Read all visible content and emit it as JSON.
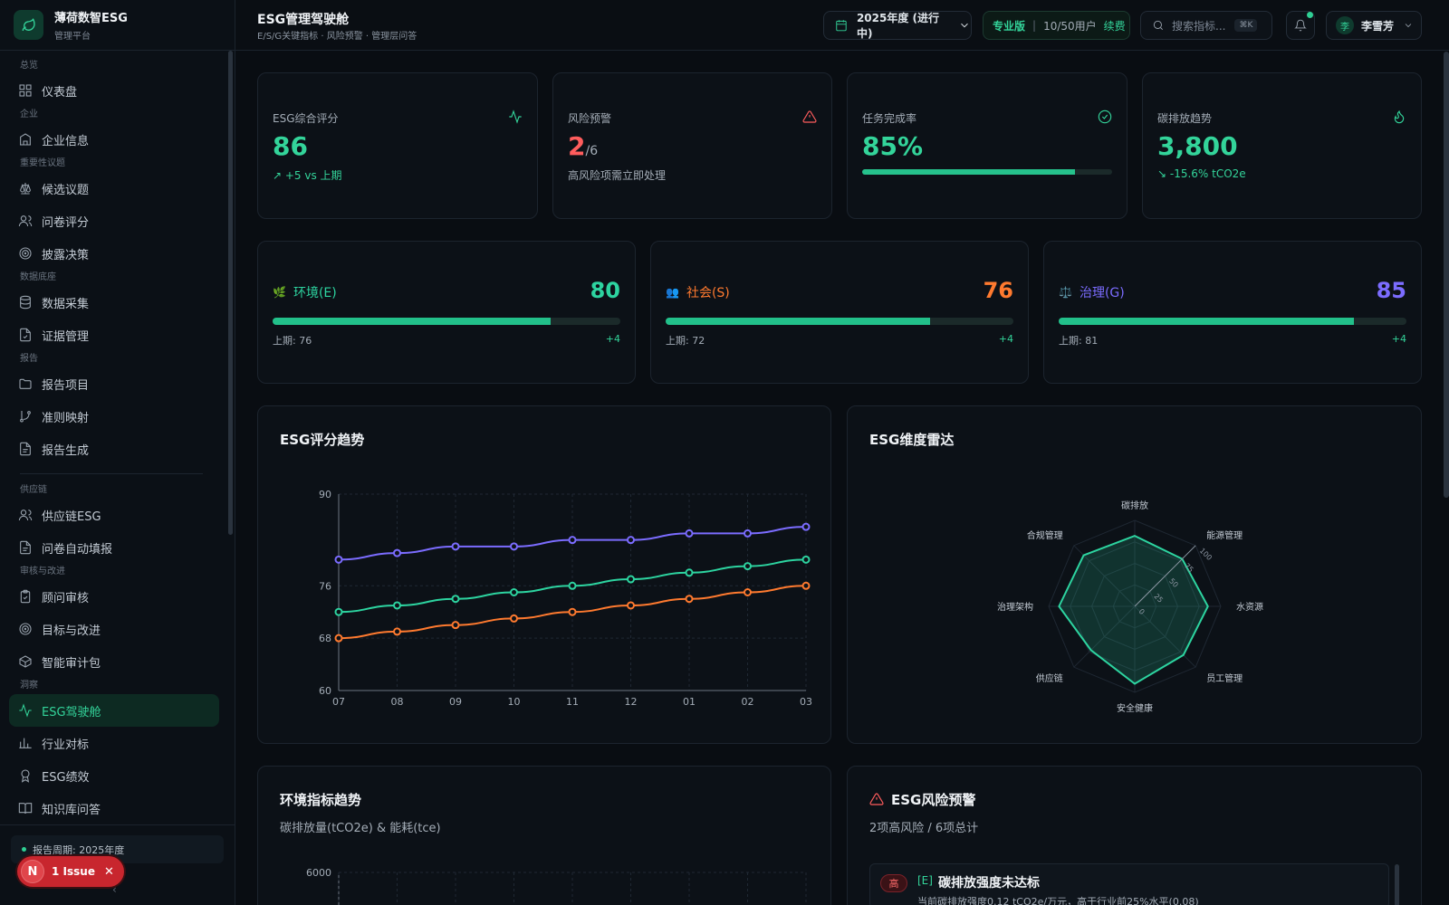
{
  "brand": {
    "name": "薄荷数智ESG",
    "sub": "管理平台"
  },
  "sidebar": {
    "groups": {
      "overview": "总览",
      "company": "企业",
      "materiality": "重要性议题",
      "data": "数据底座",
      "report": "报告",
      "supply": "供应链",
      "audit": "审核与改进",
      "insight": "洞察"
    },
    "items": [
      {
        "label": "仪表盘",
        "icon": "grid-icon"
      },
      {
        "label": "企业信息",
        "icon": "building-icon"
      },
      {
        "label": "候选议题",
        "icon": "scale-icon"
      },
      {
        "label": "问卷评分",
        "icon": "users-icon"
      },
      {
        "label": "披露决策",
        "icon": "target-icon"
      },
      {
        "label": "数据采集",
        "icon": "database-icon"
      },
      {
        "label": "证据管理",
        "icon": "file-check-icon"
      },
      {
        "label": "报告项目",
        "icon": "folder-icon"
      },
      {
        "label": "准则映射",
        "icon": "git-branch-icon"
      },
      {
        "label": "报告生成",
        "icon": "file-text-icon"
      },
      {
        "label": "供应链ESG",
        "icon": "users-icon"
      },
      {
        "label": "问卷自动填报",
        "icon": "file-text-icon"
      },
      {
        "label": "顾问审核",
        "icon": "clipboard-icon"
      },
      {
        "label": "目标与改进",
        "icon": "target-icon"
      },
      {
        "label": "智能审计包",
        "icon": "package-icon"
      },
      {
        "label": "ESG驾驶舱",
        "icon": "activity-icon"
      },
      {
        "label": "行业对标",
        "icon": "bar-chart-icon"
      },
      {
        "label": "ESG绩效",
        "icon": "award-icon"
      },
      {
        "label": "知识库问答",
        "icon": "book-icon"
      }
    ],
    "period": "报告周期: 2025年度",
    "collapse": "‹"
  },
  "issue": {
    "avatar": "N",
    "label": "1 Issue",
    "close": "✕"
  },
  "header": {
    "title": "ESG管理驾驶舱",
    "subtitle": "E/S/G关键指标 · 风险预警 · 管理层问答",
    "year": "2025年度 (进行中)",
    "plan": "专业版",
    "users": "10/50用户",
    "renew": "续费",
    "search_placeholder": "搜索指标...",
    "shortcut": "⌘K",
    "user_avatar": "李",
    "user_name": "李雪芳"
  },
  "kpis": {
    "score": {
      "label": "ESG综合评分",
      "value": "86",
      "note": "↗ +5 vs 上期"
    },
    "risk": {
      "label": "风险预警",
      "value": "2",
      "total": "/6",
      "note": "高风险项需立即处理"
    },
    "task": {
      "label": "任务完成率",
      "value": "85%",
      "progress": 0.85
    },
    "carbon": {
      "label": "碳排放趋势",
      "value": "3,800",
      "note": "↘ -15.6% tCO2e"
    }
  },
  "dimensions": {
    "e": {
      "icon": "🌿",
      "label": "环境(E)",
      "score": "80",
      "progress": 0.8,
      "prev": "上期: 76",
      "delta": "+4",
      "color": "#2dd4a0"
    },
    "s": {
      "icon": "👥",
      "label": "社会(S)",
      "score": "76",
      "progress": 0.76,
      "prev": "上期: 72",
      "delta": "+4",
      "color": "#ff7a2f"
    },
    "g": {
      "icon": "⚖️",
      "label": "治理(G)",
      "score": "85",
      "progress": 0.85,
      "prev": "上期: 81",
      "delta": "+4",
      "color": "#7b6cff"
    }
  },
  "trend": {
    "title": "ESG评分趋势"
  },
  "radar": {
    "title": "ESG维度雷达"
  },
  "env": {
    "title": "环境指标趋势",
    "subtitle": "碳排放量(tCO2e) & 能耗(tce)"
  },
  "risks": {
    "title": "ESG风险预警",
    "subtitle": "2项高风险 / 6项总计",
    "items": [
      {
        "level": "高",
        "tag": "[E]",
        "title": "碳排放强度未达标",
        "desc": "当前碳排放强度0.12 tCO2e/万元，高于行业前25%水平(0.08)"
      }
    ]
  },
  "chart_data": [
    {
      "type": "line",
      "title": "ESG评分趋势",
      "categories": [
        "07",
        "08",
        "09",
        "10",
        "11",
        "12",
        "01",
        "02",
        "03"
      ],
      "y_ticks": [
        60,
        68,
        76,
        90
      ],
      "ylim": [
        60,
        90
      ],
      "grid": true,
      "series": [
        {
          "color": "#7b6cff",
          "values": [
            80,
            81,
            82,
            82,
            83,
            83,
            84,
            84,
            85
          ]
        },
        {
          "color": "#2dd4a0",
          "values": [
            72,
            73,
            74,
            75,
            76,
            77,
            78,
            79,
            80
          ]
        },
        {
          "color": "#ff7a2f",
          "values": [
            68,
            69,
            70,
            71,
            72,
            73,
            74,
            75,
            76
          ]
        }
      ]
    },
    {
      "type": "radar",
      "title": "ESG维度雷达",
      "axes": [
        "碳排放",
        "能源管理",
        "水资源",
        "员工管理",
        "安全健康",
        "供应链",
        "治理架构",
        "合规管理"
      ],
      "values": [
        82,
        78,
        85,
        80,
        90,
        72,
        88,
        84
      ],
      "r_ticks": [
        "0",
        "25",
        "50",
        "75",
        "100"
      ],
      "rlim": [
        0,
        100
      ],
      "color": "#2dd4a0"
    },
    {
      "type": "line",
      "title": "环境指标趋势",
      "y_ticks": [
        6000
      ]
    }
  ]
}
